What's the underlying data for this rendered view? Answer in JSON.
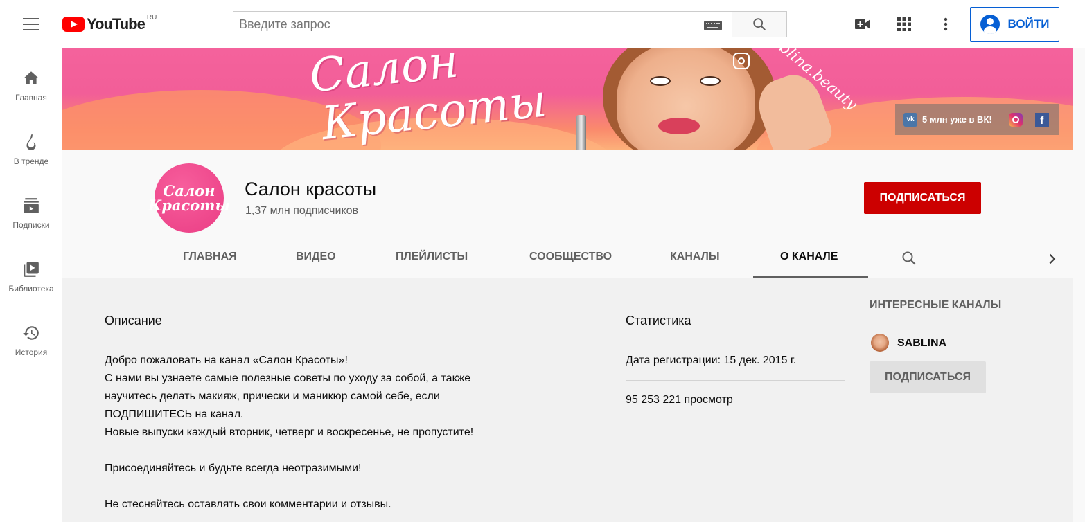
{
  "topbar": {
    "logo_text": "YouTube",
    "logo_region": "RU",
    "search_placeholder": "Введите запрос",
    "login_label": "ВОЙТИ"
  },
  "sidebar": {
    "items": [
      {
        "label": "Главная",
        "icon": "home-icon"
      },
      {
        "label": "В тренде",
        "icon": "fire-icon"
      },
      {
        "label": "Подписки",
        "icon": "subscriptions-icon"
      },
      {
        "label": "Библиотека",
        "icon": "library-icon"
      },
      {
        "label": "История",
        "icon": "history-icon"
      }
    ]
  },
  "banner": {
    "script_line1": "Салон",
    "script_line2": "Красоты",
    "handle": "sablina.beauty",
    "links_text": "5 млн уже в ВК!",
    "vk_label": "vk",
    "fb_label": "f"
  },
  "channel": {
    "avatar_line1": "Салон",
    "avatar_line2": "Красоты",
    "name": "Салон красоты",
    "subscribers": "1,37 млн подписчиков",
    "subscribe_label": "ПОДПИСАТЬСЯ",
    "tabs": [
      "ГЛАВНАЯ",
      "ВИДЕО",
      "ПЛЕЙЛИСТЫ",
      "СООБЩЕСТВО",
      "КАНАЛЫ",
      "О КАНАЛЕ"
    ],
    "active_tab": "О КАНАЛЕ"
  },
  "about": {
    "description_title": "Описание",
    "description_lines": [
      "Добро пожаловать на канал «Салон Красоты»!",
      "С нами вы узнаете самые полезные советы по уходу за собой, а также",
      "научитесь делать макияж, прически и маникюр самой себе, если",
      "ПОДПИШИТЕСЬ на канал.",
      "Новые выпуски каждый вторник, четверг и воскресенье, не пропустите!",
      "",
      "Присоединяйтесь и будьте всегда неотразимыми!",
      "",
      "Не стесняйтесь оставлять свои комментарии и отзывы."
    ],
    "stats_title": "Статистика",
    "registration": "Дата регистрации: 15 дек. 2015 г.",
    "views": "95 253 221 просмотр"
  },
  "related": {
    "title": "ИНТЕРЕСНЫЕ КАНАЛЫ",
    "channel_name": "SABLINA",
    "subscribe_label": "ПОДПИСАТЬСЯ"
  },
  "colors": {
    "brand_red": "#ff0000",
    "subscribe_red": "#cc0000",
    "link_blue": "#065fd4",
    "banner_pink": "#f4629c"
  }
}
